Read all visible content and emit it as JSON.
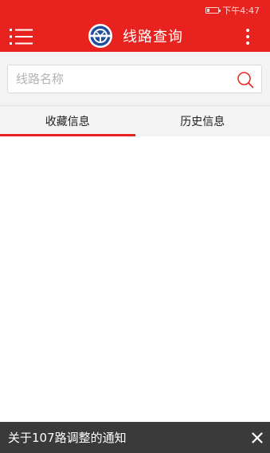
{
  "status_bar": {
    "time": "下午4:47",
    "battery_icon": "battery-low-icon"
  },
  "app_bar": {
    "menu_icon": "list-menu-icon",
    "logo_icon": "transit-logo-icon",
    "title": "线路查询",
    "more_icon": "more-vertical-icon"
  },
  "search": {
    "value": "",
    "placeholder": "线路名称",
    "icon": "search-icon"
  },
  "tabs": [
    {
      "label": "收藏信息",
      "active": true
    },
    {
      "label": "历史信息",
      "active": false
    }
  ],
  "notice": {
    "text": "关于107路调整的通知",
    "close_icon": "close-icon"
  },
  "colors": {
    "primary": "#e8231f",
    "notice_background": "#3a3a3a",
    "tab_background": "#f3f3f3"
  }
}
